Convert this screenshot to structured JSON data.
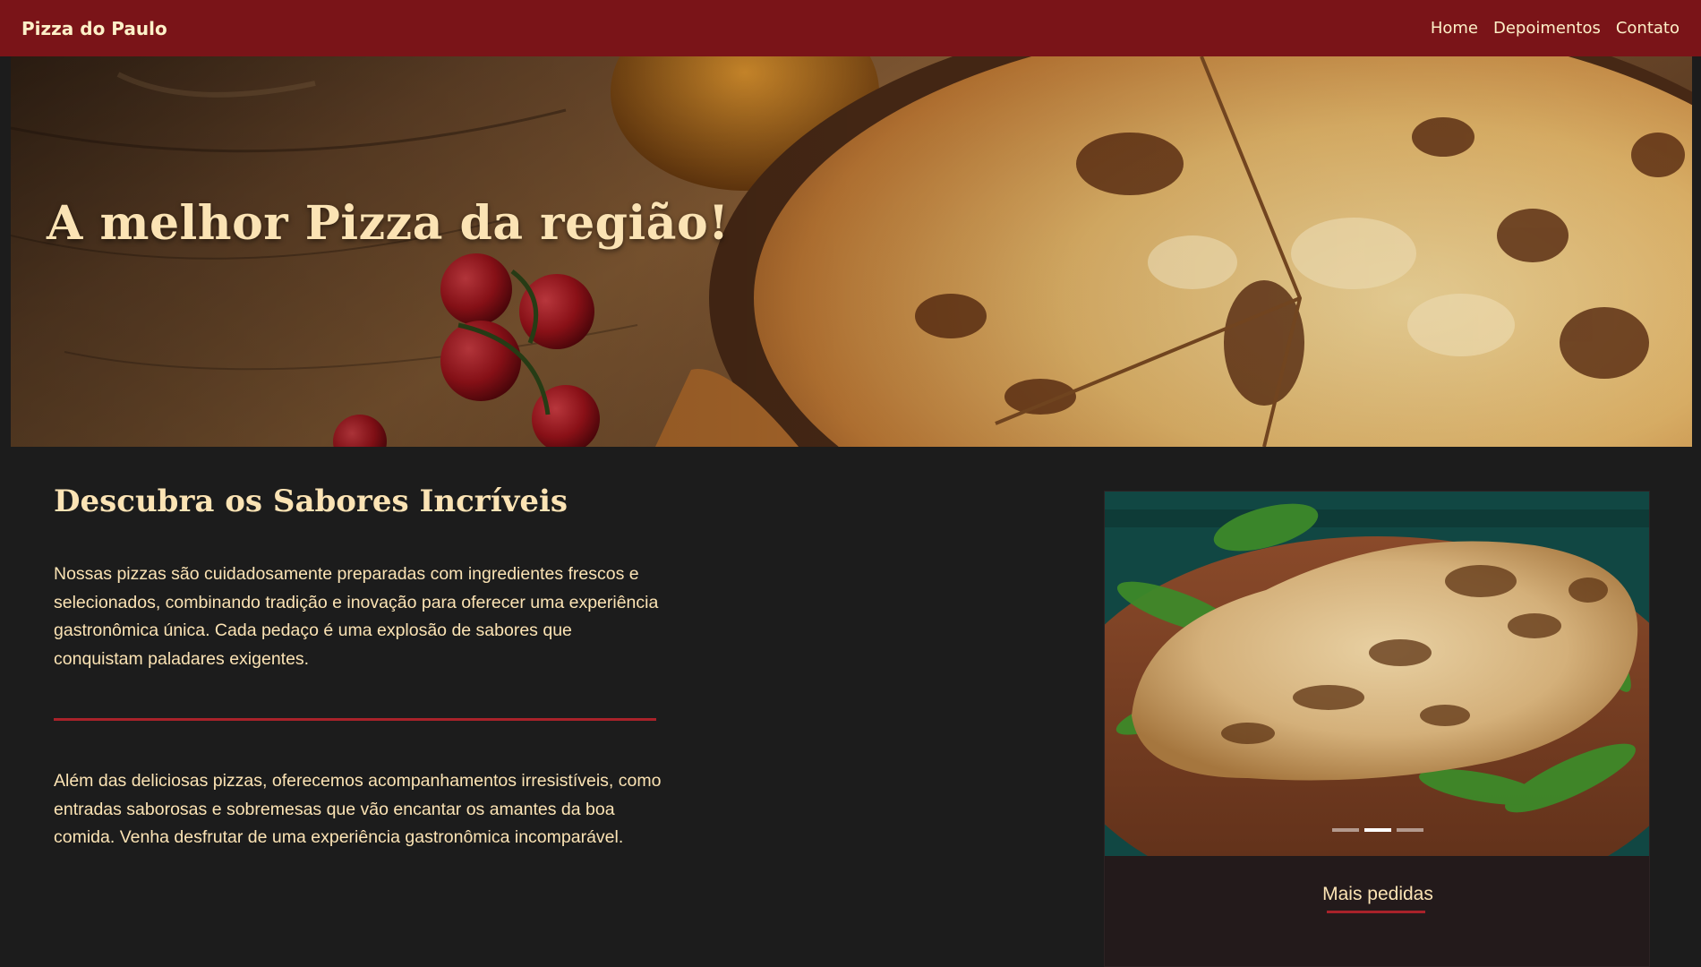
{
  "navbar": {
    "brand": "Pizza do Paulo",
    "links": [
      "Home",
      "Depoimentos",
      "Contato"
    ],
    "background_color": "#7a1418"
  },
  "hero": {
    "title": "A melhor Pizza da região!",
    "image": "pizza-on-wooden-board-photo"
  },
  "content": {
    "title": "Descubra os Sabores Incríveis",
    "paragraphs": [
      "Nossas pizzas são cuidadosamente preparadas com ingredientes frescos e selecionados, combinando tradição e inovação para oferecer uma experiência gastronômica única. Cada pedaço é uma explosão de sabores que conquistam paladares exigentes.",
      "Além das deliciosas pizzas, oferecemos acompanhamentos irresistíveis, como entradas saborosas e sobremesas que vão encantar os amantes da boa comida. Venha desfrutar de uma experiência gastronômica incomparável."
    ],
    "accent_color": "#a9222a",
    "text_color": "#fbe3b4"
  },
  "carousel": {
    "image": "flatbread-with-arugula-photo",
    "slide_count": 3,
    "active_index": 1,
    "caption": "Mais pedidas"
  }
}
